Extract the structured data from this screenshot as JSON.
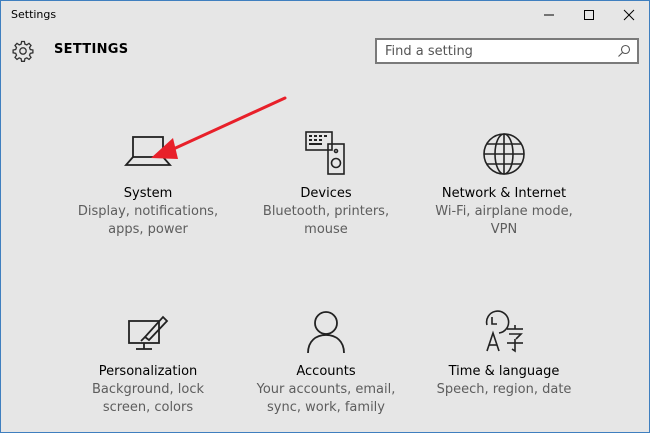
{
  "window": {
    "title": "Settings",
    "controls": [
      "minimize",
      "maximize",
      "close"
    ]
  },
  "header": {
    "title": "SETTINGS",
    "icon": "gear-icon"
  },
  "search": {
    "placeholder": "Find a setting",
    "value": "",
    "icon": "search-icon"
  },
  "tiles": [
    {
      "name": "System",
      "desc": "Display, notifications, apps, power",
      "icon": "laptop-icon"
    },
    {
      "name": "Devices",
      "desc": "Bluetooth, printers, mouse",
      "icon": "devices-icon"
    },
    {
      "name": "Network & Internet",
      "desc": "Wi-Fi, airplane mode, VPN",
      "icon": "globe-icon"
    },
    {
      "name": "Personalization",
      "desc": "Background, lock screen, colors",
      "icon": "personalization-icon"
    },
    {
      "name": "Accounts",
      "desc": "Your accounts, email, sync, work, family",
      "icon": "person-icon"
    },
    {
      "name": "Time & language",
      "desc": "Speech, region, date",
      "icon": "time-language-icon"
    }
  ],
  "annotation": {
    "color": "#e8202a"
  }
}
